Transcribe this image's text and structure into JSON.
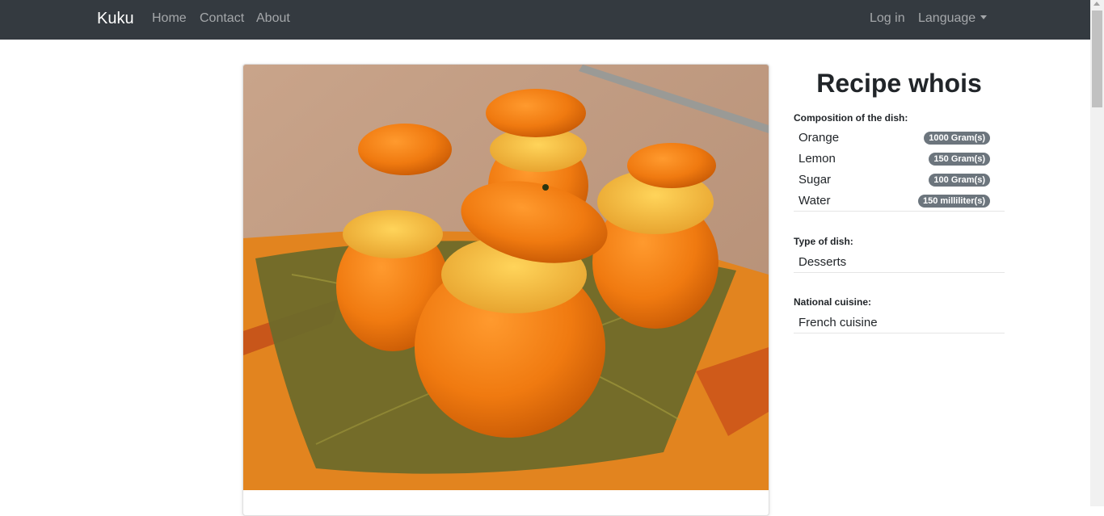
{
  "navbar": {
    "brand": "Kuku",
    "links": [
      "Home",
      "Contact",
      "About"
    ],
    "login": "Log in",
    "language": "Language"
  },
  "image": {
    "alt": "Orange sorbet served in hollowed oranges on a leaf-shaped glass plate"
  },
  "recipe": {
    "title": "Recipe whois",
    "composition_label": "Composition of the dish:",
    "ingredients": [
      {
        "name": "Orange",
        "amount": "1000 Gram(s)"
      },
      {
        "name": "Lemon",
        "amount": "150 Gram(s)"
      },
      {
        "name": "Sugar",
        "amount": "100 Gram(s)"
      },
      {
        "name": "Water",
        "amount": "150 milliliter(s)"
      }
    ],
    "type_label": "Type of dish:",
    "type_value": "Desserts",
    "cuisine_label": "National cuisine:",
    "cuisine_value": "French cuisine"
  },
  "colors": {
    "navbar": "#343a40",
    "badge": "#6c757d",
    "orange": "#f07a10"
  }
}
